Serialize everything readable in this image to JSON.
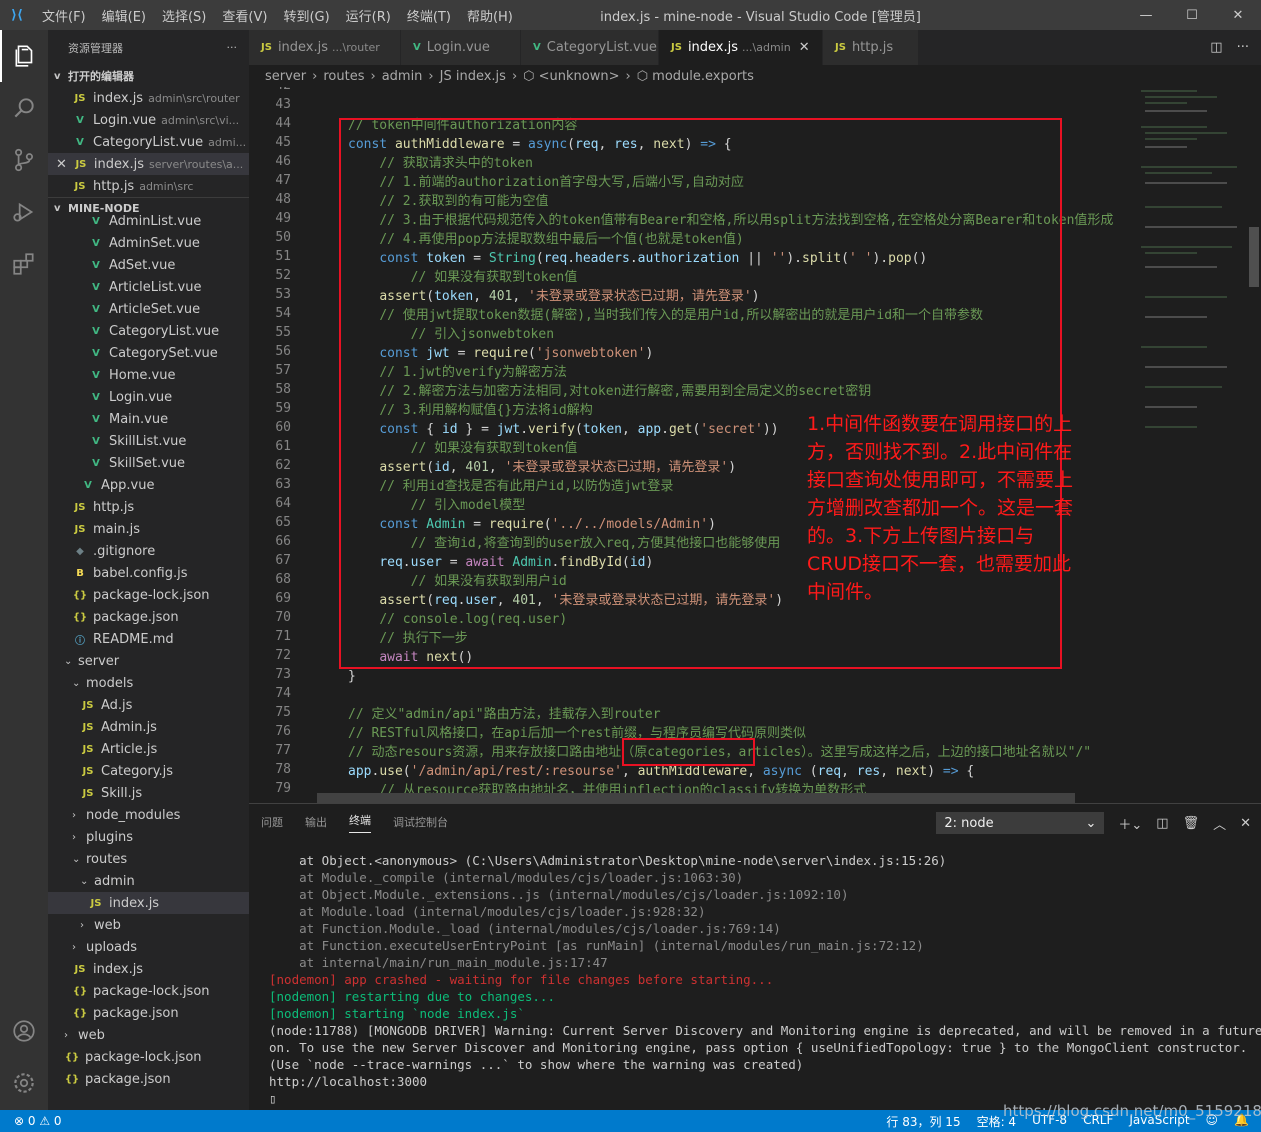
{
  "window": {
    "menu": [
      "文件(F)",
      "编辑(E)",
      "选择(S)",
      "查看(V)",
      "转到(G)",
      "运行(R)",
      "终端(T)",
      "帮助(H)"
    ],
    "title": "index.js - mine-node - Visual Studio Code [管理员]"
  },
  "sidebar": {
    "title": "资源管理器",
    "open_editors_label": "打开的编辑器",
    "open_editors": [
      {
        "icon": "JS",
        "name": "index.js",
        "hint": "admin\\src\\router"
      },
      {
        "icon": "V",
        "name": "Login.vue",
        "hint": "admin\\src\\vi..."
      },
      {
        "icon": "V",
        "name": "CategoryList.vue",
        "hint": "admi..."
      },
      {
        "icon": "JS",
        "name": "index.js",
        "hint": "server\\routes\\a..."
      },
      {
        "icon": "JS",
        "name": "http.js",
        "hint": "admin\\src"
      }
    ],
    "project_label": "MINE-NODE",
    "tree": [
      {
        "icon": "V",
        "name": "AdminList.vue"
      },
      {
        "icon": "V",
        "name": "AdminSet.vue"
      },
      {
        "icon": "V",
        "name": "AdSet.vue"
      },
      {
        "icon": "V",
        "name": "ArticleList.vue"
      },
      {
        "icon": "V",
        "name": "ArticleSet.vue"
      },
      {
        "icon": "V",
        "name": "CategoryList.vue"
      },
      {
        "icon": "V",
        "name": "CategorySet.vue"
      },
      {
        "icon": "V",
        "name": "Home.vue"
      },
      {
        "icon": "V",
        "name": "Login.vue"
      },
      {
        "icon": "V",
        "name": "Main.vue"
      },
      {
        "icon": "V",
        "name": "SkillList.vue"
      },
      {
        "icon": "V",
        "name": "SkillSet.vue"
      },
      {
        "icon": "V",
        "name": "App.vue"
      },
      {
        "icon": "JS",
        "name": "http.js"
      },
      {
        "icon": "JS",
        "name": "main.js"
      },
      {
        "icon": "◆",
        "name": ".gitignore"
      },
      {
        "icon": "B",
        "name": "babel.config.js"
      },
      {
        "icon": "{}",
        "name": "package-lock.json"
      },
      {
        "icon": "{}",
        "name": "package.json"
      },
      {
        "icon": "ⓘ",
        "name": "README.md"
      },
      {
        "icon": "v",
        "name": "server"
      },
      {
        "icon": "v",
        "name": "models"
      },
      {
        "icon": "JS",
        "name": "Ad.js"
      },
      {
        "icon": "JS",
        "name": "Admin.js"
      },
      {
        "icon": "JS",
        "name": "Article.js"
      },
      {
        "icon": "JS",
        "name": "Category.js"
      },
      {
        "icon": "JS",
        "name": "Skill.js"
      },
      {
        "icon": ">",
        "name": "node_modules"
      },
      {
        "icon": ">",
        "name": "plugins"
      },
      {
        "icon": "v",
        "name": "routes"
      },
      {
        "icon": "v",
        "name": "admin"
      },
      {
        "icon": "JS",
        "name": "index.js"
      },
      {
        "icon": ">",
        "name": "web"
      },
      {
        "icon": ">",
        "name": "uploads"
      },
      {
        "icon": "JS",
        "name": "index.js"
      },
      {
        "icon": "{}",
        "name": "package-lock.json"
      },
      {
        "icon": "{}",
        "name": "package.json"
      },
      {
        "icon": ">",
        "name": "web"
      },
      {
        "icon": "{}",
        "name": "package-lock.json"
      },
      {
        "icon": "{}",
        "name": "package.json"
      }
    ]
  },
  "tabs": [
    {
      "icon": "JS",
      "name": "index.js",
      "sub": "...\\router"
    },
    {
      "icon": "V",
      "name": "Login.vue",
      "sub": ""
    },
    {
      "icon": "V",
      "name": "CategoryList.vue",
      "sub": ""
    },
    {
      "icon": "JS",
      "name": "index.js",
      "sub": "...\\admin",
      "close": "✕"
    },
    {
      "icon": "JS",
      "name": "http.js",
      "sub": ""
    }
  ],
  "breadcrumbs": [
    "server",
    "›",
    "routes",
    "›",
    "admin",
    "›",
    "JS index.js",
    "›",
    "⬡ <unknown>",
    "›",
    "⬡ module.exports"
  ],
  "editor": {
    "line_numbers": [
      "42",
      "43",
      "44",
      "45",
      "46",
      "47",
      "48",
      "49",
      "50",
      "51",
      "52",
      "53",
      "54",
      "55",
      "56",
      "57",
      "58",
      "59",
      "60",
      "61",
      "62",
      "63",
      "64",
      "65",
      "66",
      "67",
      "68",
      "69",
      "70",
      "71",
      "72",
      "73",
      "74",
      "75",
      "76",
      "77",
      "78",
      "79"
    ],
    "annotation": "1.中间件函数要在调用接口的上方，否则找不到。2.此中间件在接口查询处使用即可，不需要上方增删改查都加一个。这是一套的。3.下方上传图片接口与CRUD接口不一套，也需要加此中间件。"
  },
  "panel": {
    "tabs": [
      "问题",
      "输出",
      "终端",
      "调试控制台"
    ],
    "terminal_select": "2: node",
    "terminal_lines": [
      {
        "cls": "",
        "text": "    at Object.<anonymous> (C:\\Users\\Administrator\\Desktop\\mine-node\\server\\index.js:15:26)"
      },
      {
        "cls": "dim",
        "text": "    at Module._compile (internal/modules/cjs/loader.js:1063:30)"
      },
      {
        "cls": "dim",
        "text": "    at Object.Module._extensions..js (internal/modules/cjs/loader.js:1092:10)"
      },
      {
        "cls": "dim",
        "text": "    at Module.load (internal/modules/cjs/loader.js:928:32)"
      },
      {
        "cls": "dim",
        "text": "    at Function.Module._load (internal/modules/cjs/loader.js:769:14)"
      },
      {
        "cls": "dim",
        "text": "    at Function.executeUserEntryPoint [as runMain] (internal/modules/run_main.js:72:12)"
      },
      {
        "cls": "dim",
        "text": "    at internal/main/run_main_module.js:17:47"
      },
      {
        "cls": "red",
        "text": "[nodemon] app crashed - waiting for file changes before starting..."
      },
      {
        "cls": "grn",
        "text": "[nodemon] restarting due to changes..."
      },
      {
        "cls": "grn",
        "text": "[nodemon] starting `node index.js`"
      },
      {
        "cls": "",
        "text": "(node:11788) [MONGODB DRIVER] Warning: Current Server Discovery and Monitoring engine is deprecated, and will be removed in a future versi"
      },
      {
        "cls": "",
        "text": "on. To use the new Server Discover and Monitoring engine, pass option { useUnifiedTopology: true } to the MongoClient constructor."
      },
      {
        "cls": "",
        "text": "(Use `node --trace-warnings ...` to show where the warning was created)"
      },
      {
        "cls": "",
        "text": "http://localhost:3000"
      },
      {
        "cls": "",
        "text": "▯"
      }
    ]
  },
  "statusbar": {
    "left": "⊗ 0 ⚠ 0",
    "position": "行 83，列 15",
    "spaces": "空格: 4",
    "encoding": "UTF-8",
    "eol": "CRLF",
    "language": "JavaScript"
  },
  "watermark": "https://blog.csdn.net/m0_51592186"
}
